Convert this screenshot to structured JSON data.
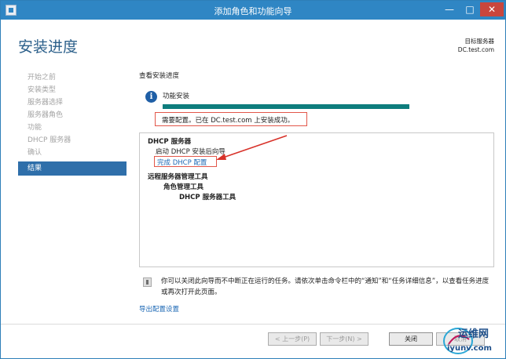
{
  "window": {
    "title": "添加角色和功能向导",
    "controls": {
      "minimize": "—",
      "maximize": "□",
      "close": "✕"
    }
  },
  "header": {
    "page_title": "安装进度",
    "target_label": "目标服务器",
    "target_value": "DC.test.com"
  },
  "nav": {
    "items": [
      "开始之前",
      "安装类型",
      "服务器选择",
      "服务器角色",
      "功能",
      "DHCP 服务器",
      "确认",
      "结果"
    ],
    "active_index": 7
  },
  "main": {
    "section_label": "查看安装进度",
    "info_icon": "i",
    "feature_label": "功能安装",
    "progress_fraction": 1.0,
    "status_text": "需要配置。已在 DC.test.com 上安装成功。",
    "results": {
      "dhcp_server": "DHCP 服务器",
      "launch_wizard": "启动 DHCP 安装后向导",
      "complete_link": "完成 DHCP 配置",
      "rsat": "远程服务器管理工具",
      "role_admin": "角色管理工具",
      "dhcp_tools": "DHCP 服务器工具"
    },
    "note": "你可以关闭此向导而不中断正在运行的任务。请依次单击命令栏中的“通知”和“任务详细信息”，以查看任务进度或再次打开此页面。",
    "export_link": "导出配置设置"
  },
  "footer": {
    "prev": "< 上一步(P)",
    "next": "下一步(N) >",
    "close": "关闭",
    "cancel": "取消"
  },
  "watermark": {
    "cn": "运维网",
    "domain": "iyunv.com"
  },
  "colors": {
    "titlebar": "#2f86c4",
    "accent": "#2f6faa",
    "progress": "#0e7d7d",
    "highlight": "#e2574a",
    "link": "#1e69b5"
  }
}
